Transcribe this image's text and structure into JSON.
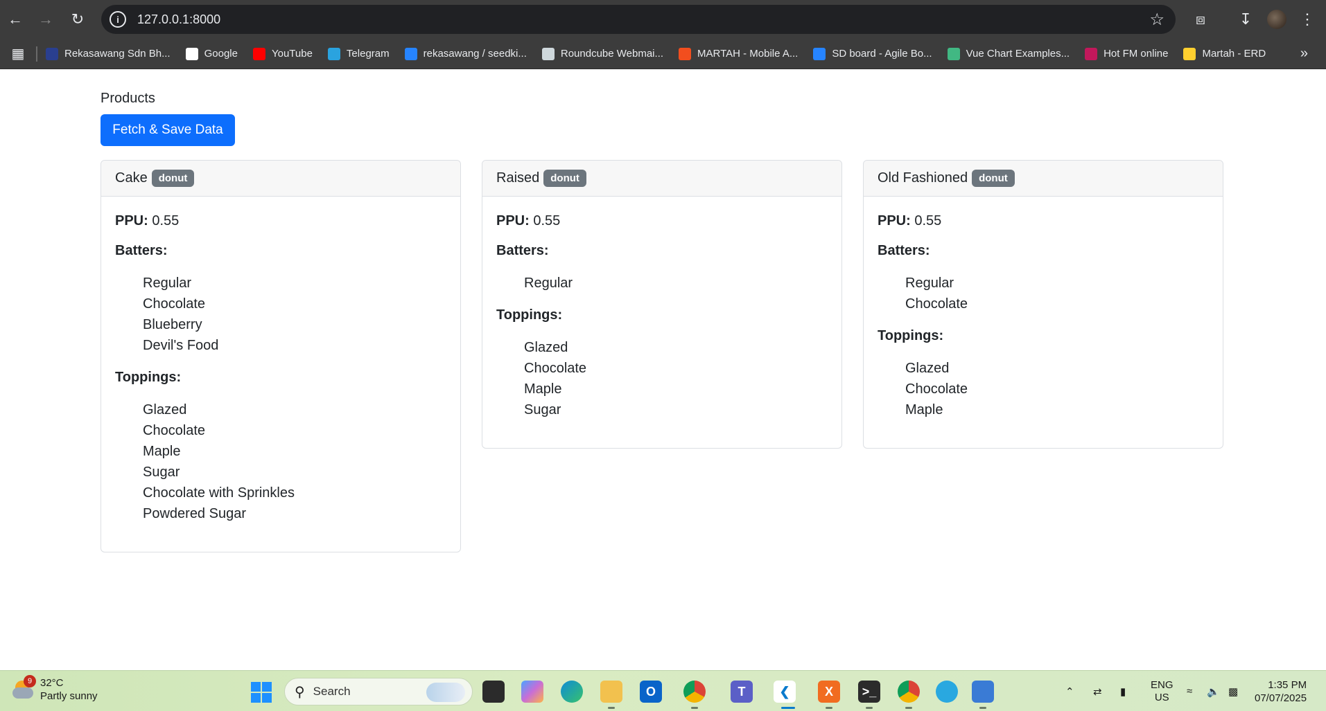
{
  "browser": {
    "url": "127.0.0.1:8000",
    "bookmarks": [
      {
        "label": "Rekasawang Sdn Bh...",
        "color": "#2a3f8f"
      },
      {
        "label": "Google",
        "color": "#ffffff"
      },
      {
        "label": "YouTube",
        "color": "#ff0000"
      },
      {
        "label": "Telegram",
        "color": "#2aa3df"
      },
      {
        "label": "rekasawang / seedki...",
        "color": "#2684ff"
      },
      {
        "label": "Roundcube Webmai...",
        "color": "#cfd8dc"
      },
      {
        "label": "MARTAH - Mobile A...",
        "color": "#f24e1e"
      },
      {
        "label": "SD board - Agile Bo...",
        "color": "#2684ff"
      },
      {
        "label": "Vue Chart Examples...",
        "color": "#41b883"
      },
      {
        "label": "Hot FM online",
        "color": "#c2185b"
      },
      {
        "label": "Martah - ERD",
        "color": "#ffd02f"
      }
    ]
  },
  "page": {
    "heading": "Products",
    "fetch_button": "Fetch & Save Data",
    "ppu_label": "PPU:",
    "batters_label": "Batters:",
    "toppings_label": "Toppings:",
    "products": [
      {
        "name": "Cake",
        "type": "donut",
        "ppu": "0.55",
        "batters": [
          "Regular",
          "Chocolate",
          "Blueberry",
          "Devil's Food"
        ],
        "toppings": [
          "Glazed",
          "Chocolate",
          "Maple",
          "Sugar",
          "Chocolate with Sprinkles",
          "Powdered Sugar"
        ]
      },
      {
        "name": "Raised",
        "type": "donut",
        "ppu": "0.55",
        "batters": [
          "Regular"
        ],
        "toppings": [
          "Glazed",
          "Chocolate",
          "Maple",
          "Sugar"
        ]
      },
      {
        "name": "Old Fashioned",
        "type": "donut",
        "ppu": "0.55",
        "batters": [
          "Regular",
          "Chocolate"
        ],
        "toppings": [
          "Glazed",
          "Chocolate",
          "Maple"
        ]
      }
    ]
  },
  "taskbar": {
    "weather_temp": "32°C",
    "weather_desc": "Partly sunny",
    "weather_badge": "9",
    "search_placeholder": "Search",
    "lang_line1": "ENG",
    "lang_line2": "US",
    "time": "1:35 PM",
    "date": "07/07/2025"
  }
}
